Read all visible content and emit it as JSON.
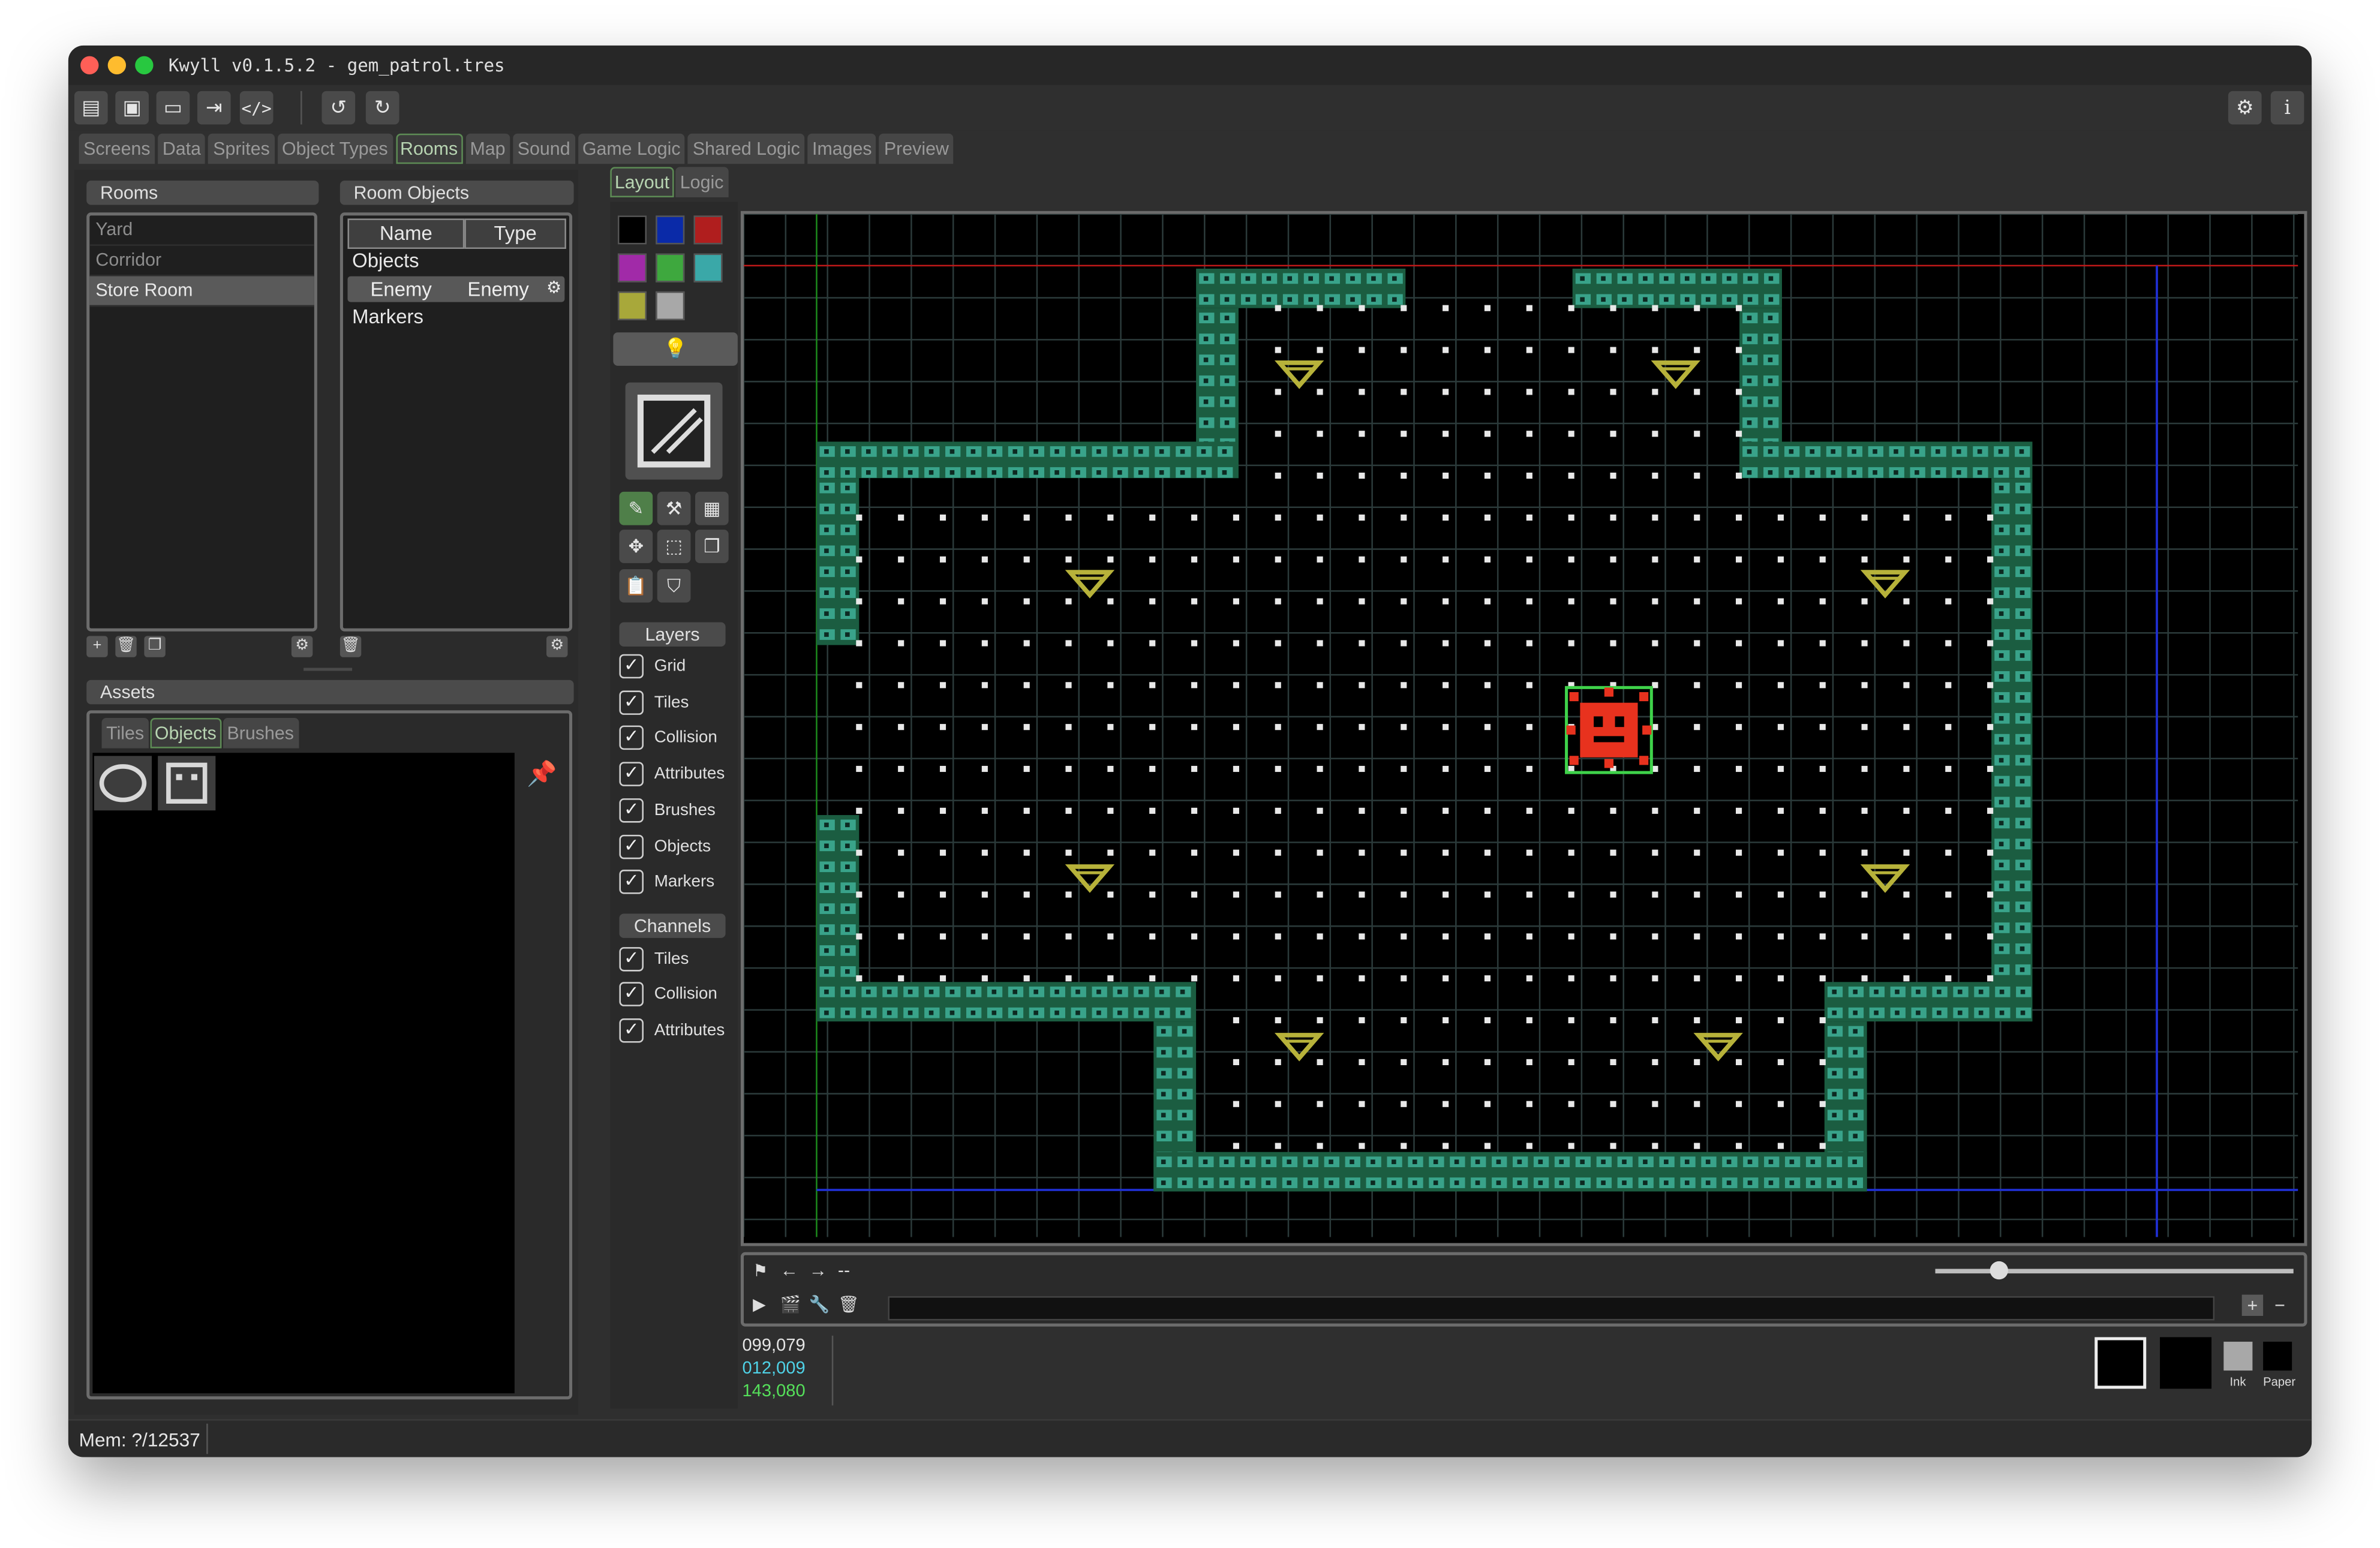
{
  "window": {
    "title": "Kwyll v0.1.5.2 - gem_patrol.tres"
  },
  "toolbar": {
    "icons": [
      "new-file-icon",
      "save-icon",
      "open-folder-icon",
      "export-icon",
      "code-icon",
      "undo-icon",
      "redo-icon",
      "settings-icon",
      "info-icon"
    ]
  },
  "main_tabs": [
    "Screens",
    "Data",
    "Sprites",
    "Object Types",
    "Rooms",
    "Map",
    "Sound",
    "Game Logic",
    "Shared Logic",
    "Images",
    "Preview"
  ],
  "rooms_panel": {
    "title": "Rooms",
    "items": [
      "Yard",
      "Corridor",
      "Store Room"
    ],
    "selected": "Store Room"
  },
  "room_objects": {
    "title": "Room Objects",
    "col_name": "Name",
    "col_type": "Type",
    "group_objects": "Objects",
    "row": {
      "name": "Enemy",
      "type": "Enemy"
    },
    "group_markers": "Markers"
  },
  "assets": {
    "title": "Assets",
    "tabs": [
      "Tiles",
      "Objects",
      "Brushes"
    ],
    "active_tab": "Objects"
  },
  "editor_tabs": [
    "Layout",
    "Logic"
  ],
  "palette": {
    "colors": [
      "#000000",
      "#0a2aa8",
      "#b01e1e",
      "#a12aa8",
      "#3ea83e",
      "#3aa8a8",
      "#a8a83a",
      "#a8a8a8"
    ]
  },
  "layers": {
    "title": "Layers",
    "items": [
      "Grid",
      "Tiles",
      "Collision",
      "Attributes",
      "Brushes",
      "Objects",
      "Markers"
    ]
  },
  "channels": {
    "title": "Channels",
    "items": [
      "Tiles",
      "Collision",
      "Attributes"
    ]
  },
  "timeline": {
    "nav_text": "--"
  },
  "coords": {
    "a": "099,079",
    "b": "012,009",
    "c": "143,080"
  },
  "ink_paper": {
    "ink": "Ink",
    "paper": "Paper"
  },
  "status": {
    "mem": "Mem: ?/12537"
  },
  "colors": {
    "accent": "#5d8b55",
    "wall": "#2f7f5c",
    "gem": "#b7b23a",
    "enemy": "#e8321e"
  }
}
